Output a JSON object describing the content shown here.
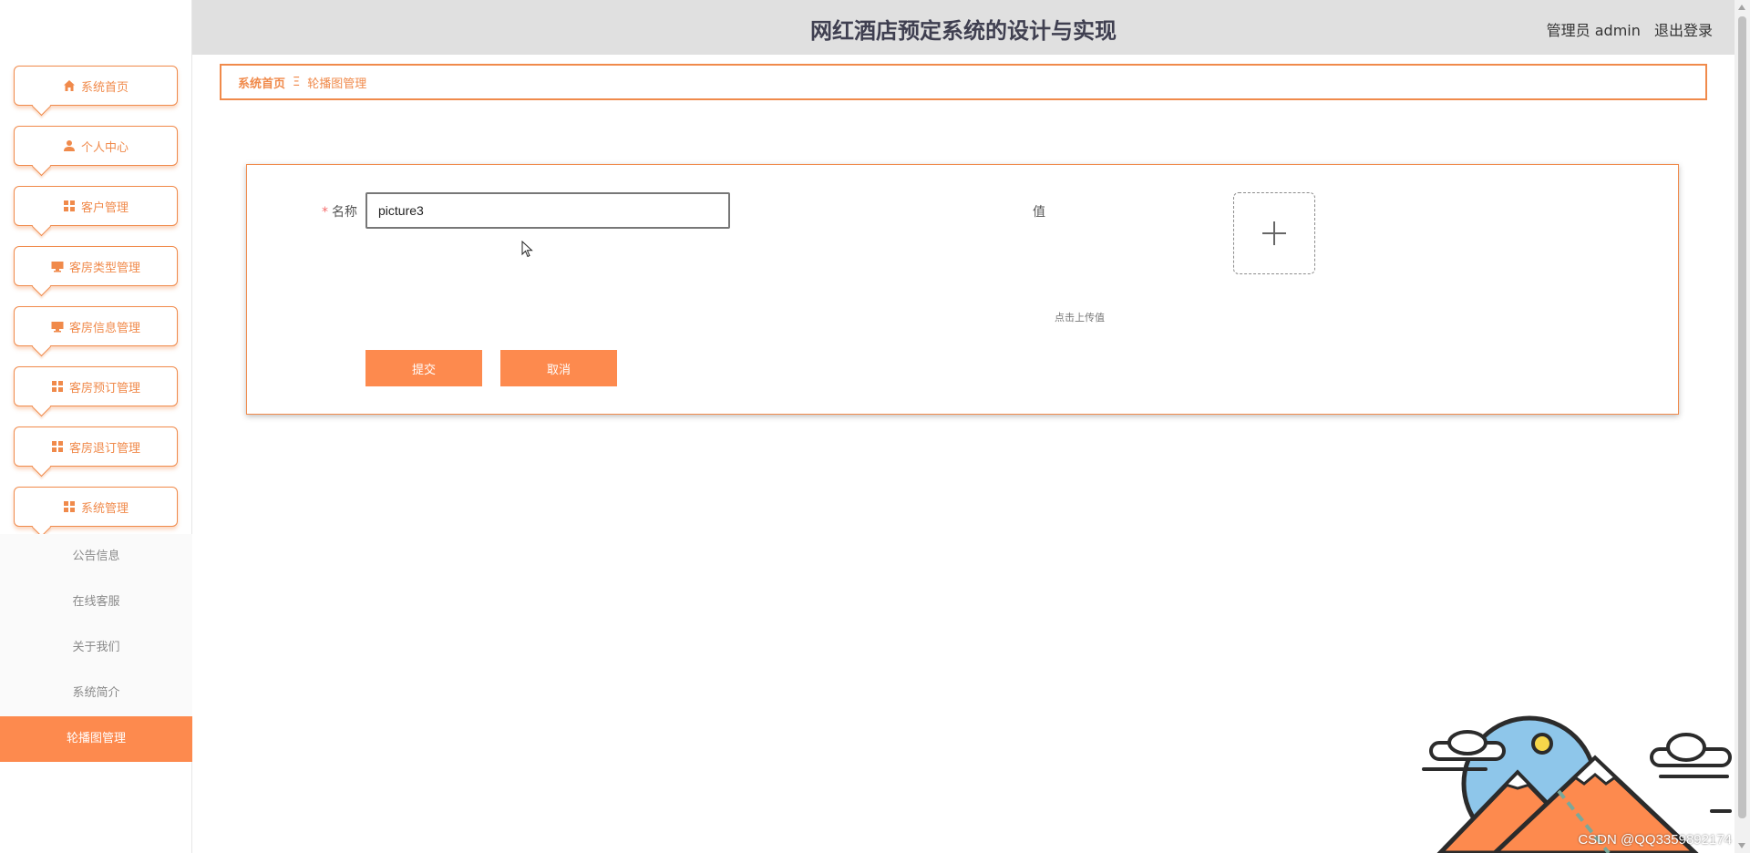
{
  "header": {
    "title": "网红酒店预定系统的设计与实现",
    "user_label": "管理员 admin",
    "logout_label": "退出登录"
  },
  "sidebar": {
    "items": [
      {
        "label": "系统首页",
        "icon": "home-icon"
      },
      {
        "label": "个人中心",
        "icon": "user-icon"
      },
      {
        "label": "客户管理",
        "icon": "grid-icon"
      },
      {
        "label": "客房类型管理",
        "icon": "monitor-icon"
      },
      {
        "label": "客房信息管理",
        "icon": "monitor-icon"
      },
      {
        "label": "客房预订管理",
        "icon": "grid-icon"
      },
      {
        "label": "客房退订管理",
        "icon": "grid-icon"
      },
      {
        "label": "系统管理",
        "icon": "grid-icon"
      }
    ],
    "submenu": [
      {
        "label": "公告信息"
      },
      {
        "label": "在线客服"
      },
      {
        "label": "关于我们"
      },
      {
        "label": "系统简介"
      },
      {
        "label": "轮播图管理",
        "active": true
      }
    ]
  },
  "breadcrumb": {
    "home": "系统首页",
    "separator": "Ξ",
    "current": "轮播图管理"
  },
  "form": {
    "required_mark": "*",
    "name_label": "名称",
    "name_value": "picture3",
    "value_label": "值",
    "upload_hint": "点击上传值",
    "submit_label": "提交",
    "cancel_label": "取消"
  },
  "watermark": "CSDN @QQ3359892174",
  "colors": {
    "accent": "#f08a4b",
    "button": "#fd8a4e",
    "header_bg": "#e0e0e0",
    "title": "#3f3f50"
  }
}
